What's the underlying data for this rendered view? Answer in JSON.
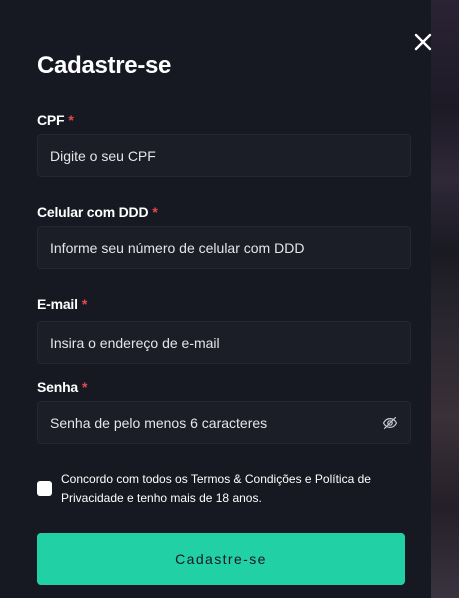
{
  "modal": {
    "title": "Cadastre-se",
    "close_icon": "close-icon"
  },
  "fields": {
    "cpf": {
      "label": "CPF",
      "required_mark": "*",
      "placeholder": "Digite o seu CPF",
      "value": ""
    },
    "phone": {
      "label": "Celular com DDD",
      "required_mark": "*",
      "placeholder": "Informe seu número de celular com DDD",
      "value": ""
    },
    "email": {
      "label": "E-mail",
      "required_mark": "*",
      "placeholder": "Insira o endereço de e-mail",
      "value": ""
    },
    "password": {
      "label": "Senha",
      "required_mark": "*",
      "placeholder": "Senha de pelo menos 6 caracteres",
      "value": "",
      "toggle_icon": "eye-off-icon"
    }
  },
  "terms": {
    "checked": false,
    "text": "Concordo com todos os Termos & Condições e Política de Privacidade e tenho mais de 18 anos."
  },
  "submit": {
    "label": "Cadastre-se"
  },
  "colors": {
    "modal_bg": "#171922",
    "input_bg": "#1b1d27",
    "accent": "#22d0a5",
    "required": "#e5484d",
    "text": "#ffffff"
  }
}
